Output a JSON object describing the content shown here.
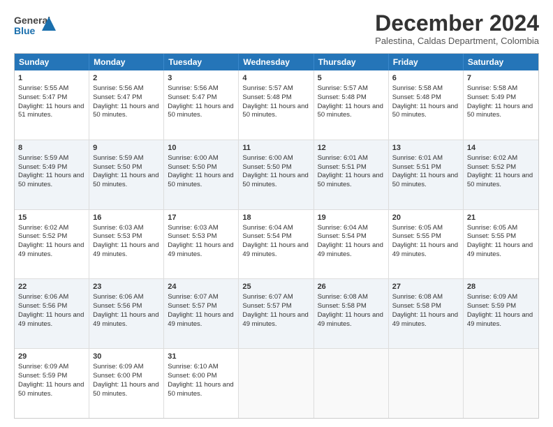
{
  "header": {
    "logo_general": "General",
    "logo_blue": "Blue",
    "month_title": "December 2024",
    "subtitle": "Palestina, Caldas Department, Colombia"
  },
  "days_of_week": [
    "Sunday",
    "Monday",
    "Tuesday",
    "Wednesday",
    "Thursday",
    "Friday",
    "Saturday"
  ],
  "weeks": [
    [
      {
        "day": "1",
        "sunrise": "5:55 AM",
        "sunset": "5:47 PM",
        "daylight": "11 hours and 51 minutes"
      },
      {
        "day": "2",
        "sunrise": "5:56 AM",
        "sunset": "5:47 PM",
        "daylight": "11 hours and 50 minutes"
      },
      {
        "day": "3",
        "sunrise": "5:56 AM",
        "sunset": "5:47 PM",
        "daylight": "11 hours and 50 minutes"
      },
      {
        "day": "4",
        "sunrise": "5:57 AM",
        "sunset": "5:48 PM",
        "daylight": "11 hours and 50 minutes"
      },
      {
        "day": "5",
        "sunrise": "5:57 AM",
        "sunset": "5:48 PM",
        "daylight": "11 hours and 50 minutes"
      },
      {
        "day": "6",
        "sunrise": "5:58 AM",
        "sunset": "5:48 PM",
        "daylight": "11 hours and 50 minutes"
      },
      {
        "day": "7",
        "sunrise": "5:58 AM",
        "sunset": "5:49 PM",
        "daylight": "11 hours and 50 minutes"
      }
    ],
    [
      {
        "day": "8",
        "sunrise": "5:59 AM",
        "sunset": "5:49 PM",
        "daylight": "11 hours and 50 minutes"
      },
      {
        "day": "9",
        "sunrise": "5:59 AM",
        "sunset": "5:50 PM",
        "daylight": "11 hours and 50 minutes"
      },
      {
        "day": "10",
        "sunrise": "6:00 AM",
        "sunset": "5:50 PM",
        "daylight": "11 hours and 50 minutes"
      },
      {
        "day": "11",
        "sunrise": "6:00 AM",
        "sunset": "5:50 PM",
        "daylight": "11 hours and 50 minutes"
      },
      {
        "day": "12",
        "sunrise": "6:01 AM",
        "sunset": "5:51 PM",
        "daylight": "11 hours and 50 minutes"
      },
      {
        "day": "13",
        "sunrise": "6:01 AM",
        "sunset": "5:51 PM",
        "daylight": "11 hours and 50 minutes"
      },
      {
        "day": "14",
        "sunrise": "6:02 AM",
        "sunset": "5:52 PM",
        "daylight": "11 hours and 50 minutes"
      }
    ],
    [
      {
        "day": "15",
        "sunrise": "6:02 AM",
        "sunset": "5:52 PM",
        "daylight": "11 hours and 49 minutes"
      },
      {
        "day": "16",
        "sunrise": "6:03 AM",
        "sunset": "5:53 PM",
        "daylight": "11 hours and 49 minutes"
      },
      {
        "day": "17",
        "sunrise": "6:03 AM",
        "sunset": "5:53 PM",
        "daylight": "11 hours and 49 minutes"
      },
      {
        "day": "18",
        "sunrise": "6:04 AM",
        "sunset": "5:54 PM",
        "daylight": "11 hours and 49 minutes"
      },
      {
        "day": "19",
        "sunrise": "6:04 AM",
        "sunset": "5:54 PM",
        "daylight": "11 hours and 49 minutes"
      },
      {
        "day": "20",
        "sunrise": "6:05 AM",
        "sunset": "5:55 PM",
        "daylight": "11 hours and 49 minutes"
      },
      {
        "day": "21",
        "sunrise": "6:05 AM",
        "sunset": "5:55 PM",
        "daylight": "11 hours and 49 minutes"
      }
    ],
    [
      {
        "day": "22",
        "sunrise": "6:06 AM",
        "sunset": "5:56 PM",
        "daylight": "11 hours and 49 minutes"
      },
      {
        "day": "23",
        "sunrise": "6:06 AM",
        "sunset": "5:56 PM",
        "daylight": "11 hours and 49 minutes"
      },
      {
        "day": "24",
        "sunrise": "6:07 AM",
        "sunset": "5:57 PM",
        "daylight": "11 hours and 49 minutes"
      },
      {
        "day": "25",
        "sunrise": "6:07 AM",
        "sunset": "5:57 PM",
        "daylight": "11 hours and 49 minutes"
      },
      {
        "day": "26",
        "sunrise": "6:08 AM",
        "sunset": "5:58 PM",
        "daylight": "11 hours and 49 minutes"
      },
      {
        "day": "27",
        "sunrise": "6:08 AM",
        "sunset": "5:58 PM",
        "daylight": "11 hours and 49 minutes"
      },
      {
        "day": "28",
        "sunrise": "6:09 AM",
        "sunset": "5:59 PM",
        "daylight": "11 hours and 49 minutes"
      }
    ],
    [
      {
        "day": "29",
        "sunrise": "6:09 AM",
        "sunset": "5:59 PM",
        "daylight": "11 hours and 50 minutes"
      },
      {
        "day": "30",
        "sunrise": "6:09 AM",
        "sunset": "6:00 PM",
        "daylight": "11 hours and 50 minutes"
      },
      {
        "day": "31",
        "sunrise": "6:10 AM",
        "sunset": "6:00 PM",
        "daylight": "11 hours and 50 minutes"
      },
      null,
      null,
      null,
      null
    ]
  ],
  "labels": {
    "sunrise": "Sunrise:",
    "sunset": "Sunset:",
    "daylight": "Daylight:"
  }
}
